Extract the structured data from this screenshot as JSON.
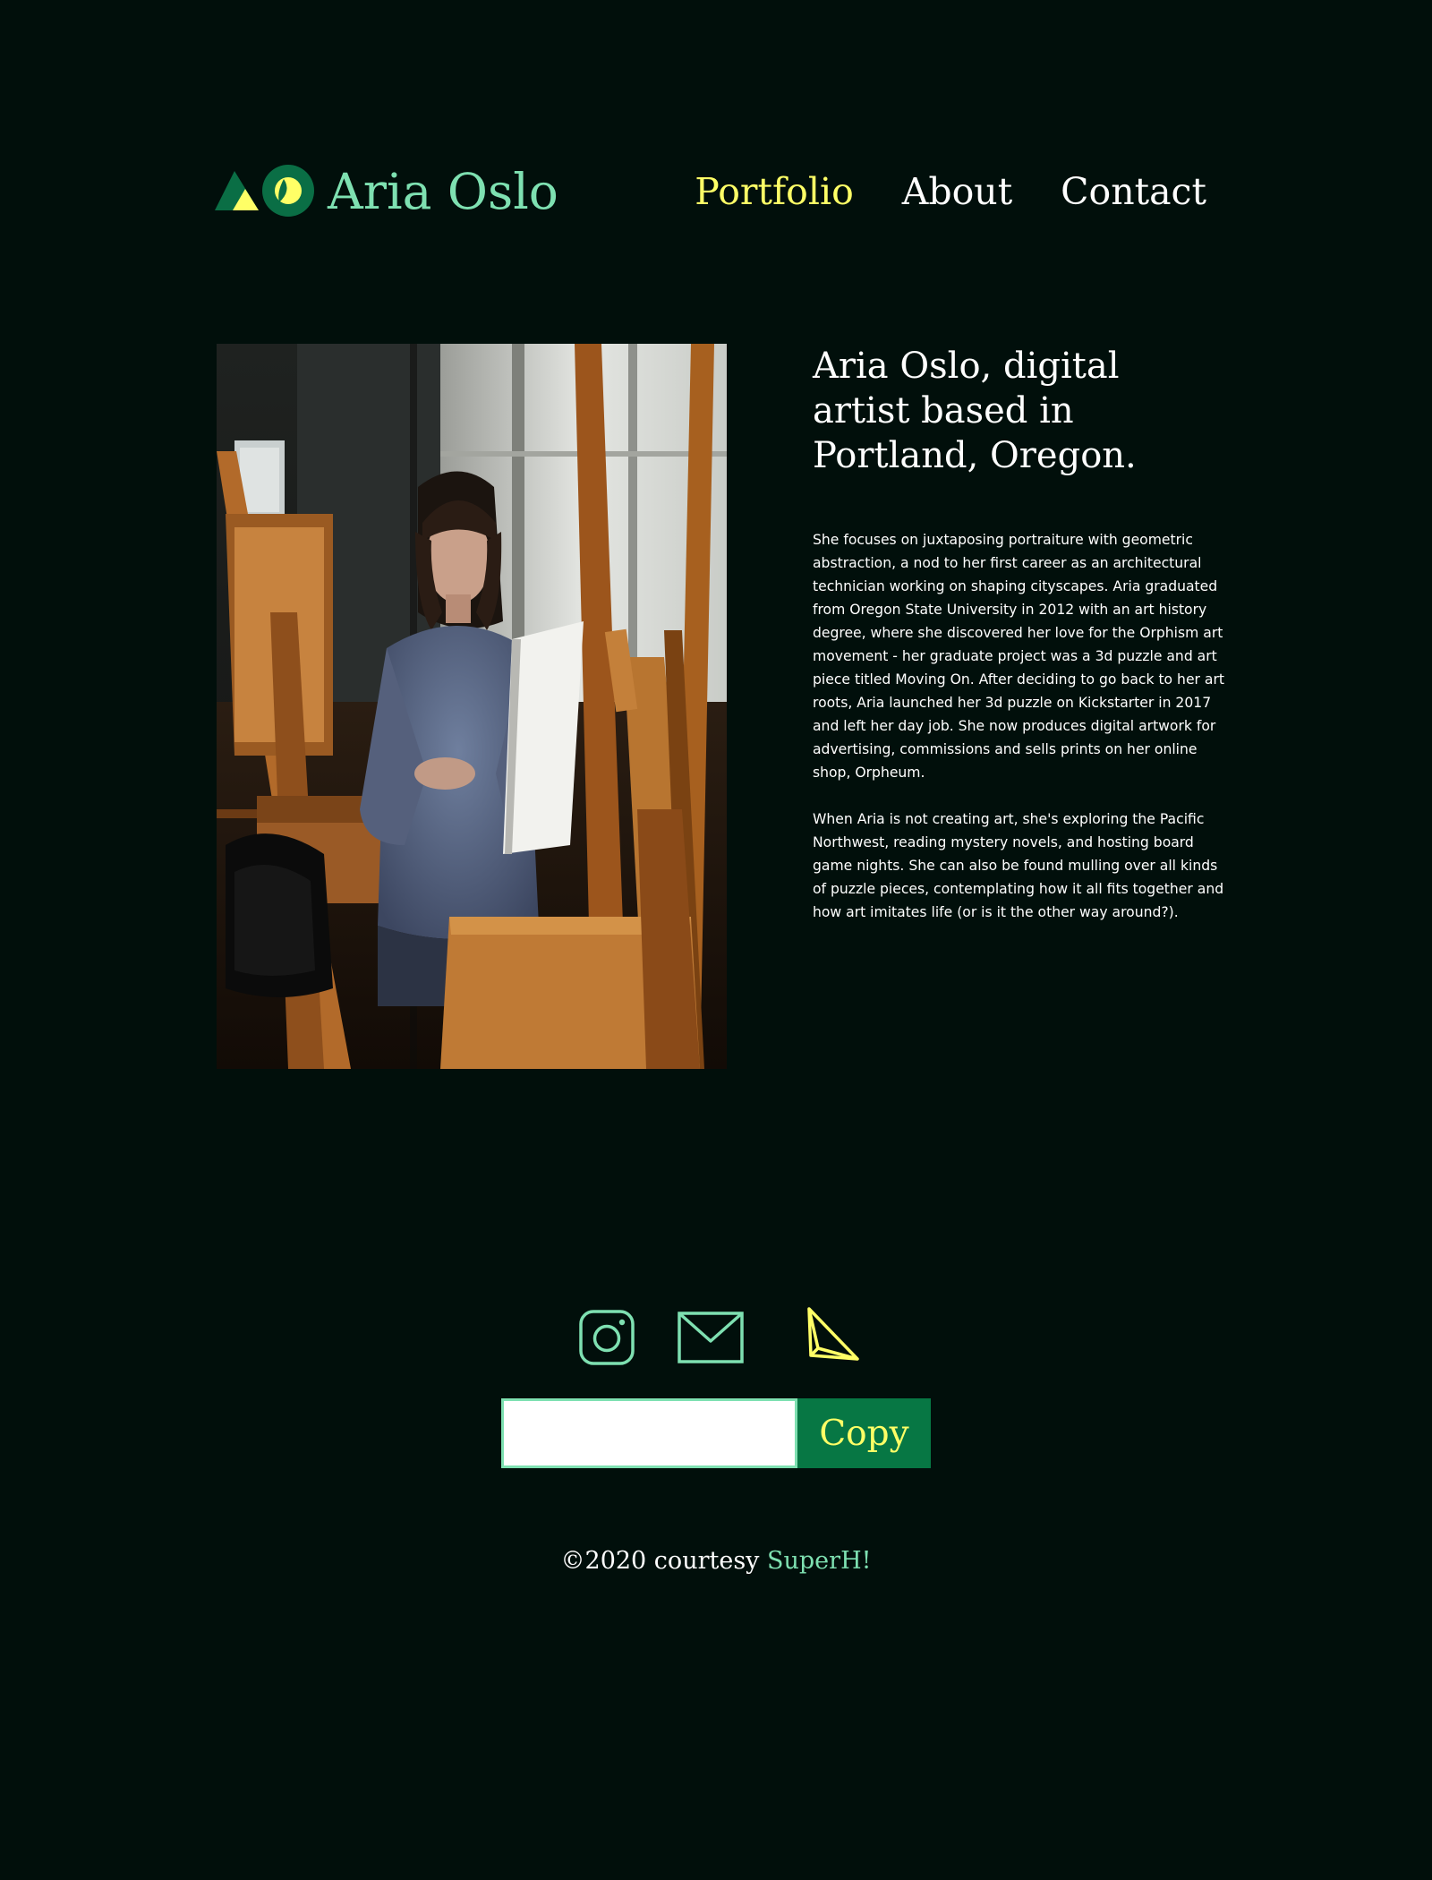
{
  "header": {
    "logo_text": "Aria Oslo",
    "nav": [
      {
        "label": "Portfolio",
        "active": true
      },
      {
        "label": "About",
        "active": false
      },
      {
        "label": "Contact",
        "active": false
      }
    ]
  },
  "hero_image": {
    "icon": "portrait-photo"
  },
  "bio": {
    "heading": "Aria Oslo, digital artist based in Portland, Oregon.",
    "paragraphs": [
      "She focuses on juxtaposing portraiture with geometric abstraction, a nod to her first career as an architectural technician working on shaping cityscapes. Aria graduated from Oregon State University in 2012 with an art history degree, where she discovered her love for the Orphism art movement - her graduate project was a 3d puzzle and art piece titled Moving On. After deciding to go back to her art roots, Aria launched her 3d puzzle on Kickstarter in 2017 and left her day job. She now produces digital artwork for advertising, commissions and sells prints on her online shop, Orpheum.",
      "When Aria is not creating art, she's exploring the Pacific Northwest, reading mystery novels, and hosting board game nights. She can also be found mulling over  all kinds of puzzle pieces, contemplating how it all fits together and how art imitates life (or is it the other way around?)."
    ]
  },
  "social": [
    {
      "icon": "instagram-icon"
    },
    {
      "icon": "mail-icon"
    },
    {
      "icon": "paper-plane-icon"
    }
  ],
  "share": {
    "input_value": "",
    "button_label": "Copy"
  },
  "footer": {
    "prefix": "©2020 courtesy ",
    "link_text": "SuperH!"
  },
  "colors": {
    "background": "#010f0b",
    "accent_green": "#7ee0b1",
    "dark_green": "#077744",
    "highlight_yellow": "#ffff66",
    "text": "#ffffff"
  }
}
